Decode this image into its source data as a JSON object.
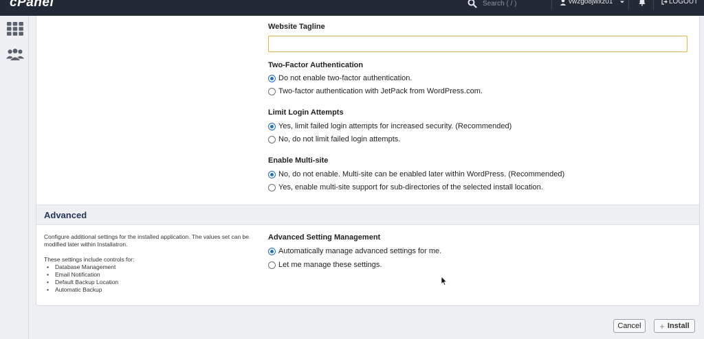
{
  "topbar": {
    "brand": "cPanel",
    "search_placeholder": "Search ( / )",
    "username": "vwzgo8jwxz01",
    "logout_label": "LOGOUT"
  },
  "sidebar": {
    "items": [
      {
        "icon": "grid-icon"
      },
      {
        "icon": "users-icon"
      }
    ]
  },
  "form": {
    "tagline_label": "Website Tagline",
    "tagline_value": "",
    "two_factor": {
      "label": "Two-Factor Authentication",
      "options": [
        {
          "label": "Do not enable two-factor authentication.",
          "selected": true
        },
        {
          "label": "Two-factor authentication with JetPack from WordPress.com.",
          "selected": false
        }
      ]
    },
    "limit_login": {
      "label": "Limit Login Attempts",
      "options": [
        {
          "label": "Yes, limit failed login attempts for increased security. (Recommended)",
          "selected": true
        },
        {
          "label": "No, do not limit failed login attempts.",
          "selected": false
        }
      ]
    },
    "multisite": {
      "label": "Enable Multi-site",
      "options": [
        {
          "label": "No, do not enable. Multi-site can be enabled later within WordPress. (Recommended)",
          "selected": true
        },
        {
          "label": "Yes, enable multi-site support for sub-directories of the selected install location.",
          "selected": false
        }
      ]
    }
  },
  "advanced": {
    "title": "Advanced",
    "description": "Configure additional settings for the installed application. The values set can be modified later within Installatron.",
    "controls_intro": "These settings include controls for:",
    "controls": [
      "Database Management",
      "Email Notification",
      "Default Backup Location",
      "Automatic Backup"
    ],
    "setting_label": "Advanced Setting Management",
    "options": [
      {
        "label": "Automatically manage advanced settings for me.",
        "selected": true
      },
      {
        "label": "Let me manage these settings.",
        "selected": false
      }
    ]
  },
  "actions": {
    "cancel_label": "Cancel",
    "install_label": "Install"
  },
  "colors": {
    "topbar": "#222a36",
    "accent": "#1a6fd6",
    "section_title": "#26355a",
    "input_border": "#e0b64a"
  }
}
